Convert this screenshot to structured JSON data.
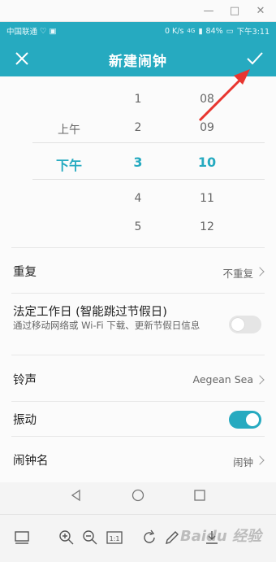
{
  "window": {
    "minimize_glyph": "—",
    "maximize_glyph": "□",
    "close_glyph": "✕"
  },
  "statusbar": {
    "carrier": "中国联通",
    "speed": "0 K/s",
    "network": "4G",
    "battery": "84%",
    "time": "下午3:11"
  },
  "appbar": {
    "title": "新建闹钟",
    "close_icon": "close-icon",
    "confirm_icon": "check-icon"
  },
  "picker": {
    "ampm": [
      "上午",
      "下午"
    ],
    "selected_ampm": "下午",
    "hours": [
      "1",
      "2",
      "3",
      "4",
      "5"
    ],
    "selected_hour": "3",
    "minutes": [
      "08",
      "09",
      "10",
      "11",
      "12"
    ],
    "selected_minute": "10"
  },
  "settings": {
    "repeat": {
      "label": "重复",
      "value": "不重复"
    },
    "workday": {
      "label": "法定工作日 (智能跳过节假日)",
      "sub": "通过移动网络或 Wi-Fi 下载、更新节假日信息",
      "enabled": false
    },
    "ringtone": {
      "label": "铃声",
      "value": "Aegean Sea"
    },
    "vibrate": {
      "label": "振动",
      "enabled": true
    },
    "name": {
      "label": "闹钟名",
      "value": "闹钟"
    }
  },
  "watermark": "Baidu 经验",
  "colors": {
    "accent": "#26aac0",
    "arrow": "#e8352f"
  }
}
